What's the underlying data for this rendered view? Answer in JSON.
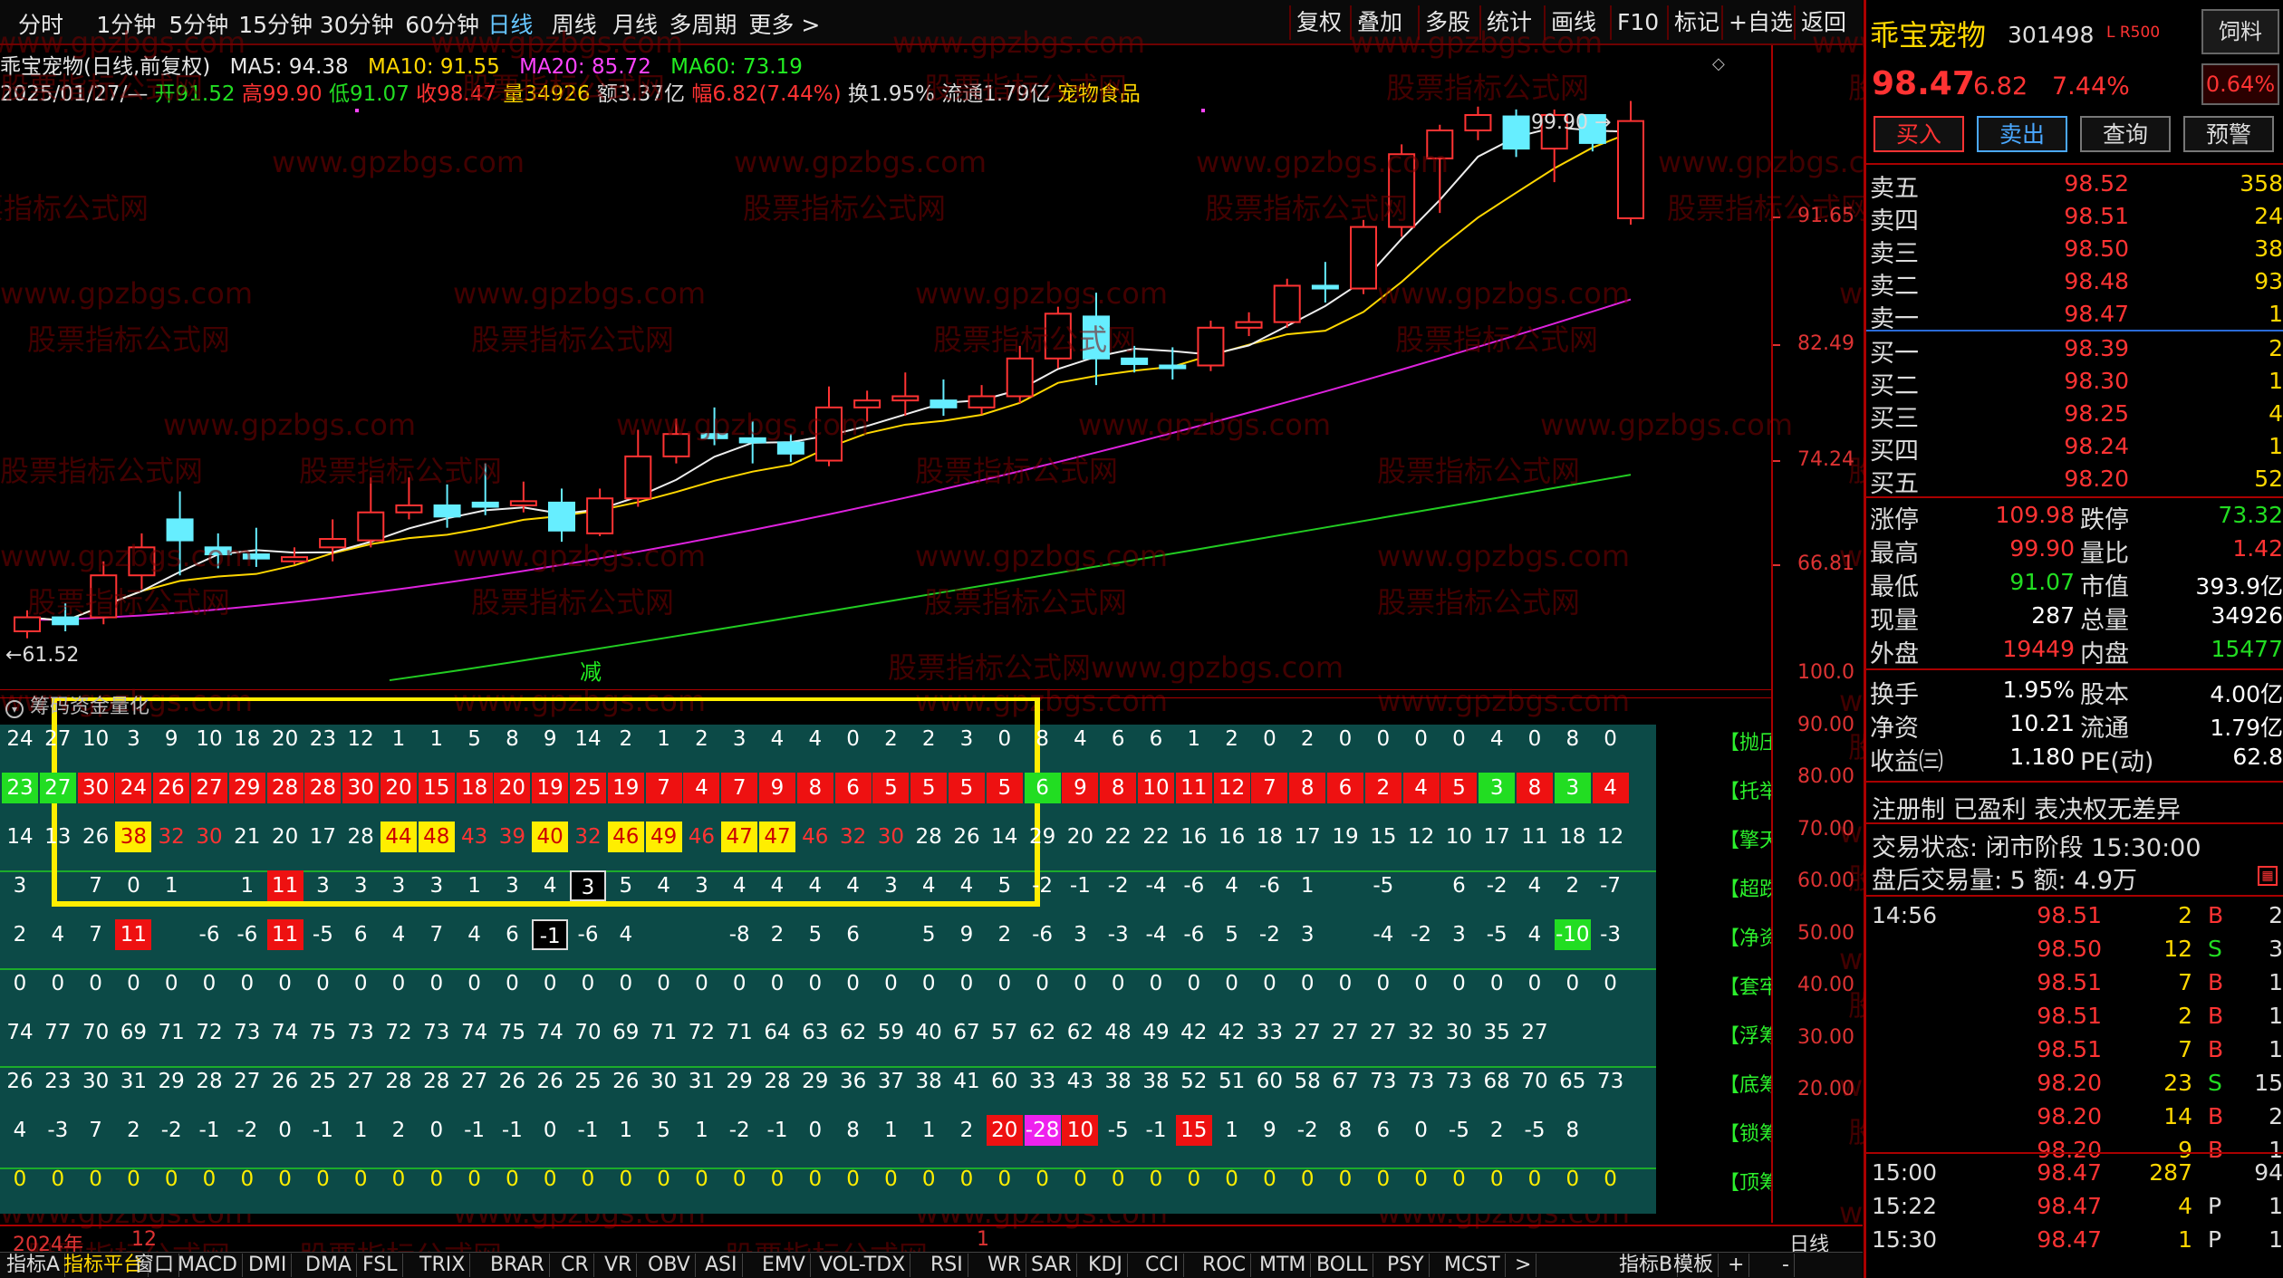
{
  "toolbar": {
    "periods": [
      "分时",
      "1分钟",
      "5分钟",
      "15分钟",
      "30分钟",
      "60分钟",
      "日线",
      "周线",
      "月线",
      "多周期",
      "更多 >"
    ],
    "active": "日线",
    "right_buttons": [
      "复权",
      "叠加",
      "多股",
      "统计",
      "画线",
      "F10",
      "标记",
      "+自选",
      "返回"
    ]
  },
  "info": {
    "name": "乖宝宠物(日线,前复权)",
    "ma5": "MA5: 94.38",
    "ma10": "MA10: 91.55",
    "ma20": "MA20: 85.72",
    "ma60": "MA60: 73.19",
    "date": "2025/01/27/—",
    "open": "开91.52",
    "high": "高99.90",
    "low": "低91.07",
    "close": "收98.47",
    "vol": "量34926",
    "amt": "额3.37亿",
    "chg": "幅6.82(7.44%)",
    "turnover": "换1.95%",
    "float": "流通1.79亿",
    "sector": "宠物食品"
  },
  "chart_data": {
    "type": "candlestick",
    "y_axis_labels": [
      "91.65",
      "82.49",
      "74.24",
      "66.81"
    ],
    "hi_label": "99.90",
    "lo_label": "←61.52",
    "marker": "减",
    "candles": [
      [
        62,
        63,
        61.5,
        63.5
      ],
      [
        63,
        62.5,
        62,
        64
      ],
      [
        63,
        66,
        62.5,
        67
      ],
      [
        66,
        68,
        65,
        69
      ],
      [
        70,
        68.5,
        66,
        72
      ],
      [
        68,
        67.5,
        66.5,
        69
      ],
      [
        67.5,
        67.2,
        66.6,
        69.4
      ],
      [
        67,
        67.3,
        66.8,
        68
      ],
      [
        68,
        68.6,
        67,
        70
      ],
      [
        68.5,
        70.5,
        68,
        73
      ],
      [
        70.5,
        71,
        70,
        73
      ],
      [
        71,
        70.2,
        69.4,
        72.5
      ],
      [
        71.2,
        70.9,
        70.3,
        74
      ],
      [
        71,
        71.3,
        70.5,
        72.7
      ],
      [
        71.2,
        69.2,
        68.4,
        72.2
      ],
      [
        69,
        71.5,
        68.8,
        72.2
      ],
      [
        71.5,
        74.5,
        70.9,
        76.4
      ],
      [
        74.5,
        76.1,
        74,
        77.2
      ],
      [
        76.1,
        75.8,
        75.3,
        78
      ],
      [
        75.8,
        75.5,
        74,
        77
      ],
      [
        75.5,
        74.7,
        74.1,
        76.1
      ],
      [
        74.2,
        78,
        73.8,
        79.5
      ],
      [
        78,
        78.5,
        77,
        79.2
      ],
      [
        78.5,
        78.8,
        77.4,
        80.5
      ],
      [
        78.5,
        78,
        77.4,
        80
      ],
      [
        78,
        78.8,
        77.5,
        79.6
      ],
      [
        78.8,
        81.5,
        78.3,
        82.4
      ],
      [
        81.5,
        84.7,
        80.8,
        85.2
      ],
      [
        84.5,
        81.5,
        79.6,
        86.2
      ],
      [
        81.5,
        81.1,
        80.5,
        82.4
      ],
      [
        81,
        80.8,
        80,
        82.3
      ],
      [
        81,
        83.7,
        80.6,
        84.2
      ],
      [
        83.7,
        84.1,
        83.1,
        84.8
      ],
      [
        84.1,
        86.7,
        83.7,
        87.2
      ],
      [
        86.7,
        86.5,
        85.5,
        88.4
      ],
      [
        86.5,
        90.9,
        86.1,
        91.4
      ],
      [
        90.9,
        96.1,
        90.2,
        96.8
      ],
      [
        95.8,
        97.8,
        91.9,
        98.2
      ],
      [
        97.8,
        98.9,
        97.1,
        99.5
      ],
      [
        98.8,
        96.5,
        95.9,
        99.3
      ],
      [
        96.5,
        98.9,
        94.1,
        99.3
      ],
      [
        98.9,
        96.9,
        96.3,
        97.6
      ],
      [
        91.52,
        98.47,
        91.07,
        99.9
      ]
    ],
    "ma_ranges": {
      "ma60": [
        58.5,
        73.19
      ],
      "ma20": [
        62.8,
        85.72
      ],
      "ma10": [
        62.2,
        91.55
      ],
      "ma5": [
        62.3,
        94.38
      ]
    }
  },
  "indicator": {
    "title": "筹码资金量化",
    "scale": [
      "100.0",
      "90.00",
      "80.00",
      "70.00",
      "60.00",
      "50.00",
      "40.00",
      "30.00",
      "20.00"
    ],
    "labels": [
      "【抛压",
      "【托举",
      "【擎天",
      "【超跌",
      "【净资",
      "【套牢",
      "【浮筹",
      "【底筹",
      "【锁筹",
      "【顶筹"
    ],
    "rows": [
      {
        "v": [
          "24",
          "27",
          "10",
          "3",
          "9",
          "10",
          "18",
          "20",
          "23",
          "12",
          "1",
          "1",
          "5",
          "8",
          "9",
          "14",
          "2",
          "1",
          "2",
          "3",
          "4",
          "4",
          "0",
          "2",
          "2",
          "3",
          "0",
          "8",
          "4",
          "6",
          "6",
          "1",
          "2",
          "0",
          "2",
          "0",
          "0",
          "0",
          "0",
          "4",
          "0",
          "8",
          "0"
        ],
        "c": [
          "w"
        ]
      },
      {
        "v": [
          "23",
          "27",
          "30",
          "24",
          "26",
          "27",
          "29",
          "28",
          "28",
          "30",
          "20",
          "15",
          "18",
          "20",
          "19",
          "25",
          "19",
          "7",
          "4",
          "7",
          "9",
          "8",
          "6",
          "5",
          "5",
          "5",
          "5",
          "6",
          "9",
          "8",
          "10",
          "11",
          "12",
          "7",
          "8",
          "6",
          "2",
          "4",
          "5",
          "3",
          "8",
          "3",
          "4"
        ],
        "c": [
          "g",
          "g",
          "r",
          "r",
          "r",
          "r",
          "r",
          "r",
          "r",
          "r",
          "r",
          "r",
          "r",
          "r",
          "r",
          "r",
          "r",
          "r",
          "r",
          "r",
          "r",
          "r",
          "r",
          "r",
          "r",
          "r",
          "r",
          "g",
          "r",
          "r",
          "r",
          "r",
          "r",
          "r",
          "r",
          "r",
          "r",
          "r",
          "r",
          "g",
          "r",
          "g",
          "r"
        ]
      },
      {
        "v": [
          "14",
          "13",
          "26",
          "38",
          "32",
          "30",
          "21",
          "20",
          "17",
          "28",
          "44",
          "48",
          "43",
          "39",
          "40",
          "32",
          "46",
          "49",
          "46",
          "47",
          "47",
          "46",
          "32",
          "30",
          "28",
          "26",
          "14",
          "29",
          "20",
          "22",
          "22",
          "16",
          "16",
          "18",
          "17",
          "19",
          "15",
          "12",
          "10",
          "17",
          "11",
          "18",
          "12"
        ],
        "c": [
          "w",
          "w",
          "w",
          "y",
          "rt",
          "rt",
          "w",
          "w",
          "w",
          "w",
          "y",
          "y",
          "rt",
          "rt",
          "y",
          "rt",
          "y",
          "y",
          "rt",
          "y",
          "y",
          "rt",
          "rt",
          "rt",
          "w",
          "w",
          "w",
          "w",
          "w",
          "w",
          "w",
          "w",
          "w",
          "w",
          "w",
          "w",
          "w",
          "w",
          "w",
          "w",
          "w",
          "w",
          "w"
        ]
      },
      {
        "v": [
          "3",
          "",
          "7",
          "0",
          "1",
          "",
          "1",
          "11",
          "3",
          "3",
          "3",
          "3",
          "1",
          "3",
          "4",
          "3",
          "5",
          "4",
          "3",
          "4",
          "4",
          "4",
          "4",
          "3",
          "4",
          "4",
          "5",
          "-2",
          "-1",
          "-2",
          "-4",
          "-6",
          "4",
          "-6",
          "1",
          "",
          "-5",
          "",
          "6",
          "-2",
          "4",
          "2",
          "-7"
        ],
        "c": [
          "w",
          "w",
          "w",
          "w",
          "w",
          "w",
          "w",
          "r",
          "w",
          "w",
          "w",
          "w",
          "w",
          "w",
          "w",
          "o",
          "w",
          "w",
          "w",
          "w",
          "w",
          "w",
          "w",
          "w",
          "w",
          "w",
          "w",
          "w",
          "w",
          "w",
          "w",
          "w",
          "w",
          "w",
          "w",
          "w",
          "w",
          "w",
          "w",
          "w",
          "w",
          "w",
          "w"
        ]
      },
      {
        "v": [
          "2",
          "4",
          "7",
          "11",
          "",
          "-6",
          "-6",
          "11",
          "-5",
          "6",
          "4",
          "7",
          "4",
          "6",
          "-1",
          "-6",
          "4",
          "",
          "",
          "-8",
          "2",
          "5",
          "6",
          "",
          "5",
          "9",
          "2",
          "-6",
          "3",
          "-3",
          "-4",
          "-6",
          "5",
          "-2",
          "3",
          "",
          "-4",
          "-2",
          "3",
          "-5",
          "4",
          "-10",
          "-3"
        ],
        "c": [
          "w",
          "w",
          "w",
          "r",
          "w",
          "w",
          "w",
          "r",
          "w",
          "w",
          "w",
          "w",
          "w",
          "w",
          "o",
          "w",
          "w",
          "w",
          "w",
          "w",
          "w",
          "w",
          "w",
          "w",
          "w",
          "w",
          "w",
          "w",
          "w",
          "w",
          "w",
          "w",
          "w",
          "w",
          "w",
          "w",
          "w",
          "w",
          "w",
          "w",
          "w",
          "g",
          "w"
        ]
      },
      {
        "v": [
          "0",
          "0",
          "0",
          "0",
          "0",
          "0",
          "0",
          "0",
          "0",
          "0",
          "0",
          "0",
          "0",
          "0",
          "0",
          "0",
          "0",
          "0",
          "0",
          "0",
          "0",
          "0",
          "0",
          "0",
          "0",
          "0",
          "0",
          "0",
          "0",
          "0",
          "0",
          "0",
          "0",
          "0",
          "0",
          "0",
          "0",
          "0",
          "0",
          "0",
          "0",
          "0",
          "0"
        ],
        "c": [
          "w"
        ]
      },
      {
        "v": [
          "74",
          "77",
          "70",
          "69",
          "71",
          "72",
          "73",
          "74",
          "75",
          "73",
          "72",
          "73",
          "74",
          "75",
          "74",
          "70",
          "69",
          "71",
          "72",
          "71",
          "64",
          "63",
          "62",
          "59",
          "40",
          "67",
          "57",
          "62",
          "62",
          "48",
          "49",
          "42",
          "42",
          "33",
          "27",
          "27",
          "27",
          "32",
          "30",
          "35",
          "27",
          "",
          ""
        ],
        "c": [
          "w"
        ]
      },
      {
        "v": [
          "26",
          "23",
          "30",
          "31",
          "29",
          "28",
          "27",
          "26",
          "25",
          "27",
          "28",
          "28",
          "27",
          "26",
          "26",
          "25",
          "26",
          "30",
          "31",
          "29",
          "28",
          "29",
          "36",
          "37",
          "38",
          "41",
          "60",
          "33",
          "43",
          "38",
          "38",
          "52",
          "51",
          "60",
          "58",
          "67",
          "73",
          "73",
          "73",
          "68",
          "70",
          "65",
          "73"
        ],
        "c": [
          "w"
        ]
      },
      {
        "v": [
          "4",
          "-3",
          "7",
          "2",
          "-2",
          "-1",
          "-2",
          "0",
          "-1",
          "1",
          "2",
          "0",
          "-1",
          "-1",
          "0",
          "-1",
          "1",
          "5",
          "1",
          "-2",
          "-1",
          "0",
          "8",
          "1",
          "1",
          "2",
          "20",
          "-28",
          "10",
          "-5",
          "-1",
          "15",
          "1",
          "9",
          "-2",
          "8",
          "6",
          "0",
          "-5",
          "2",
          "-5",
          "8",
          ""
        ],
        "c": [
          "w",
          "w",
          "w",
          "w",
          "w",
          "w",
          "w",
          "w",
          "w",
          "w",
          "w",
          "w",
          "w",
          "w",
          "w",
          "w",
          "w",
          "w",
          "w",
          "w",
          "w",
          "w",
          "w",
          "w",
          "w",
          "w",
          "r",
          "m",
          "r",
          "w",
          "w",
          "r",
          "w",
          "w",
          "w",
          "w",
          "w",
          "w",
          "w",
          "w",
          "w",
          "w",
          "w"
        ]
      },
      {
        "v": [
          "0",
          "0",
          "0",
          "0",
          "0",
          "0",
          "0",
          "0",
          "0",
          "0",
          "0",
          "0",
          "0",
          "0",
          "0",
          "0",
          "0",
          "0",
          "0",
          "0",
          "0",
          "0",
          "0",
          "0",
          "0",
          "0",
          "0",
          "0",
          "0",
          "0",
          "0",
          "0",
          "0",
          "0",
          "0",
          "0",
          "0",
          "0",
          "0",
          "0",
          "0",
          "0",
          "0"
        ],
        "c": [
          "y2"
        ]
      }
    ]
  },
  "axis": {
    "year": "2024年",
    "month": "12",
    "m1": "1",
    "period_label": "日线"
  },
  "bottom_tabs": [
    "指标A",
    "指标平台",
    "窗口",
    "MACD",
    "DMI",
    "DMA",
    "FSL",
    "TRIX",
    "BRAR",
    "CR",
    "VR",
    "OBV",
    "ASI",
    "EMV",
    "VOL-TDX",
    "RSI",
    "WR",
    "SAR",
    "KDJ",
    "CCI",
    "ROC",
    "MTM",
    "BOLL",
    "PSY",
    "MCST",
    ">",
    "指标B",
    "模板",
    "+",
    "-"
  ],
  "panel": {
    "name": "乖宝宠物",
    "code": "301498",
    "flags": "L R500",
    "sector_btn": "饲料",
    "price": "98.47",
    "chg": "6.82",
    "pct": "7.44%",
    "sector_pct": "0.64%",
    "buy_btn": "买入",
    "sell_btn": "卖出",
    "query_btn": "查询",
    "alert_btn": "预警",
    "asks": [
      {
        "l": "卖五",
        "p": "98.52",
        "v": "358"
      },
      {
        "l": "卖四",
        "p": "98.51",
        "v": "24"
      },
      {
        "l": "卖三",
        "p": "98.50",
        "v": "38"
      },
      {
        "l": "卖二",
        "p": "98.48",
        "v": "93"
      },
      {
        "l": "卖一",
        "p": "98.47",
        "v": "1"
      }
    ],
    "bids": [
      {
        "l": "买一",
        "p": "98.39",
        "v": "2"
      },
      {
        "l": "买二",
        "p": "98.30",
        "v": "1"
      },
      {
        "l": "买三",
        "p": "98.25",
        "v": "4"
      },
      {
        "l": "买四",
        "p": "98.24",
        "v": "1"
      },
      {
        "l": "买五",
        "p": "98.20",
        "v": "52"
      }
    ],
    "stats": [
      {
        "l1": "涨停",
        "v1": "109.98",
        "l2": "跌停",
        "v2": "73.32"
      },
      {
        "l1": "最高",
        "v1": "99.90",
        "l2": "量比",
        "v2": "1.42"
      },
      {
        "l1": "最低",
        "v1": "91.07",
        "l2": "市值",
        "v2": "393.9亿"
      },
      {
        "l1": "现量",
        "v1": "287",
        "l2": "总量",
        "v2": "34926"
      },
      {
        "l1": "外盘",
        "v1": "19449",
        "l2": "内盘",
        "v2": "15477"
      },
      {
        "l1": "换手",
        "v1": "1.95%",
        "l2": "股本",
        "v2": "4.00亿"
      },
      {
        "l1": "净资",
        "v1": "10.21",
        "l2": "流通",
        "v2": "1.79亿"
      },
      {
        "l1": "收益㈢",
        "v1": "1.180",
        "l2": "PE(动)",
        "v2": "62.8"
      }
    ],
    "reg": "注册制 已盈利 表决权无差异",
    "status": "交易状态: 闭市阶段 15:30:00",
    "after": "盘后交易量: 5  额: 4.9万",
    "ticks": [
      {
        "t": "14:56",
        "p": "98.51",
        "v": "2",
        "d": "B",
        "n": "2"
      },
      {
        "t": "",
        "p": "98.50",
        "v": "12",
        "d": "S",
        "n": "3"
      },
      {
        "t": "",
        "p": "98.51",
        "v": "7",
        "d": "B",
        "n": "1"
      },
      {
        "t": "",
        "p": "98.51",
        "v": "2",
        "d": "B",
        "n": "1"
      },
      {
        "t": "",
        "p": "98.51",
        "v": "7",
        "d": "B",
        "n": "1"
      },
      {
        "t": "",
        "p": "98.20",
        "v": "23",
        "d": "S",
        "n": "15"
      },
      {
        "t": "",
        "p": "98.20",
        "v": "14",
        "d": "B",
        "n": "2"
      },
      {
        "t": "",
        "p": "98.20",
        "v": "9",
        "d": "B",
        "n": "1"
      },
      {
        "t": "15:00",
        "p": "98.47",
        "v": "287",
        "d": "",
        "n": "94"
      },
      {
        "t": "15:22",
        "p": "98.47",
        "v": "4",
        "d": "P",
        "n": "1"
      },
      {
        "t": "15:30",
        "p": "98.47",
        "v": "1",
        "d": "P",
        "n": "1"
      }
    ]
  },
  "watermark": {
    "a": "www.gpzbgs.com",
    "b": "股票指标公式网",
    "c": "股票指标公式网www.gpzbgs.com"
  }
}
